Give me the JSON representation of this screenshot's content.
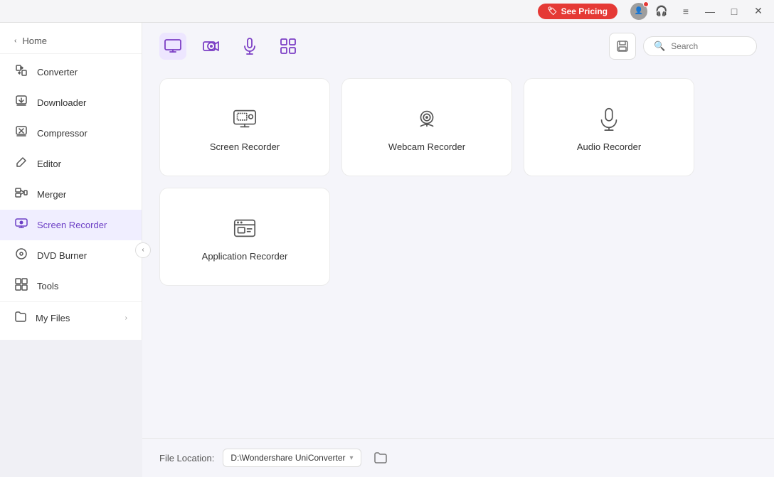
{
  "titlebar": {
    "pricing_label": "See Pricing",
    "min_label": "—",
    "max_label": "□",
    "close_label": "✕",
    "menu_label": "≡"
  },
  "sidebar": {
    "home_label": "Home",
    "items": [
      {
        "id": "converter",
        "label": "Converter",
        "icon": "converter"
      },
      {
        "id": "downloader",
        "label": "Downloader",
        "icon": "downloader"
      },
      {
        "id": "compressor",
        "label": "Compressor",
        "icon": "compressor"
      },
      {
        "id": "editor",
        "label": "Editor",
        "icon": "editor"
      },
      {
        "id": "merger",
        "label": "Merger",
        "icon": "merger"
      },
      {
        "id": "screen-recorder",
        "label": "Screen Recorder",
        "icon": "screen-recorder",
        "active": true
      },
      {
        "id": "dvd-burner",
        "label": "DVD Burner",
        "icon": "dvd-burner"
      },
      {
        "id": "tools",
        "label": "Tools",
        "icon": "tools"
      }
    ],
    "my_files_label": "My Files"
  },
  "toolbar": {
    "tabs": [
      {
        "id": "screen",
        "icon": "screen",
        "active": true
      },
      {
        "id": "webcam",
        "icon": "webcam"
      },
      {
        "id": "audio",
        "icon": "audio"
      },
      {
        "id": "apps",
        "icon": "apps"
      }
    ],
    "search_placeholder": "Search"
  },
  "recorder_cards": {
    "row1": [
      {
        "id": "screen-recorder",
        "label": "Screen Recorder"
      },
      {
        "id": "webcam-recorder",
        "label": "Webcam Recorder"
      },
      {
        "id": "audio-recorder",
        "label": "Audio Recorder"
      }
    ],
    "row2": [
      {
        "id": "application-recorder",
        "label": "Application Recorder"
      }
    ]
  },
  "file_location": {
    "label": "File Location:",
    "path": "D:\\Wondershare UniConverter "
  }
}
